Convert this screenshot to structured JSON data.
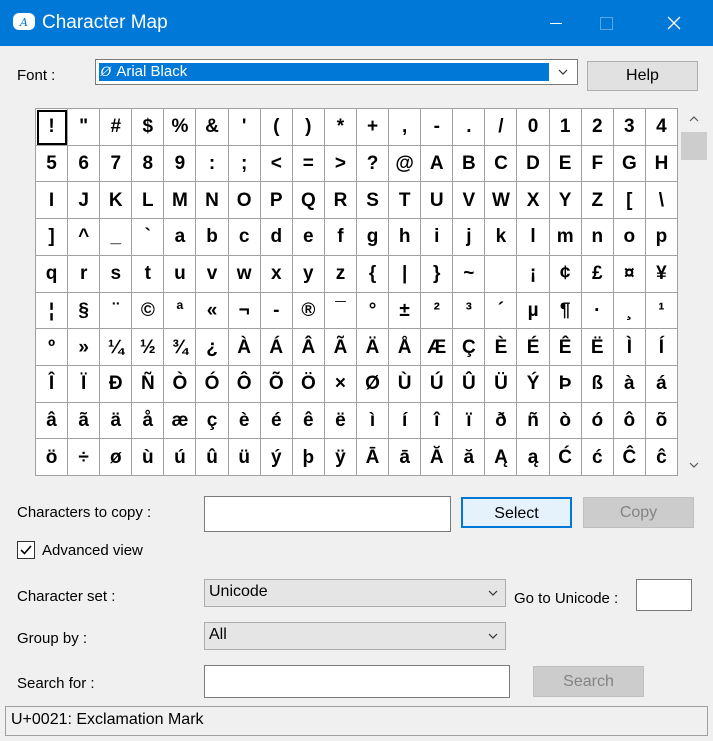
{
  "window": {
    "title": "Character Map",
    "icon": "character-map-app-icon"
  },
  "font_row": {
    "label": "Font :",
    "selected_font": "Arial Black",
    "font_icon": "opentype-font-icon",
    "help_label": "Help"
  },
  "grid": {
    "rows": [
      [
        "!",
        "\"",
        "#",
        "$",
        "%",
        "&",
        "'",
        "(",
        ")",
        "*",
        "+",
        ",",
        "-",
        ".",
        "/",
        "0",
        "1",
        "2",
        "3",
        "4"
      ],
      [
        "5",
        "6",
        "7",
        "8",
        "9",
        ":",
        ";",
        "<",
        "=",
        ">",
        "?",
        "@",
        "A",
        "B",
        "C",
        "D",
        "E",
        "F",
        "G",
        "H"
      ],
      [
        "I",
        "J",
        "K",
        "L",
        "M",
        "N",
        "O",
        "P",
        "Q",
        "R",
        "S",
        "T",
        "U",
        "V",
        "W",
        "X",
        "Y",
        "Z",
        "[",
        "\\"
      ],
      [
        "]",
        "^",
        "_",
        "`",
        "a",
        "b",
        "c",
        "d",
        "e",
        "f",
        "g",
        "h",
        "i",
        "j",
        "k",
        "l",
        "m",
        "n",
        "o",
        "p"
      ],
      [
        "q",
        "r",
        "s",
        "t",
        "u",
        "v",
        "w",
        "x",
        "y",
        "z",
        "{",
        "|",
        "}",
        "~",
        "",
        "¡",
        "¢",
        "£",
        "¤",
        "¥"
      ],
      [
        "¦",
        "§",
        "¨",
        "©",
        "ª",
        "«",
        "¬",
        "-",
        "®",
        "¯",
        "°",
        "±",
        "²",
        "³",
        "´",
        "µ",
        "¶",
        "·",
        "¸",
        "¹"
      ],
      [
        "º",
        "»",
        "¼",
        "½",
        "¾",
        "¿",
        "À",
        "Á",
        "Â",
        "Ã",
        "Ä",
        "Å",
        "Æ",
        "Ç",
        "È",
        "É",
        "Ê",
        "Ë",
        "Ì",
        "Í"
      ],
      [
        "Î",
        "Ï",
        "Ð",
        "Ñ",
        "Ò",
        "Ó",
        "Ô",
        "Õ",
        "Ö",
        "×",
        "Ø",
        "Ù",
        "Ú",
        "Û",
        "Ü",
        "Ý",
        "Þ",
        "ß",
        "à",
        "á"
      ],
      [
        "â",
        "ã",
        "ä",
        "å",
        "æ",
        "ç",
        "è",
        "é",
        "ê",
        "ë",
        "ì",
        "í",
        "î",
        "ï",
        "ð",
        "ñ",
        "ò",
        "ó",
        "ô",
        "õ"
      ],
      [
        "ö",
        "÷",
        "ø",
        "ù",
        "ú",
        "û",
        "ü",
        "ý",
        "þ",
        "ÿ",
        "Ā",
        "ā",
        "Ă",
        "ă",
        "Ą",
        "ą",
        "Ć",
        "ć",
        "Ĉ",
        "ĉ"
      ]
    ],
    "selected": "!"
  },
  "copy_row": {
    "label": "Characters to copy :",
    "value": "",
    "select_label": "Select",
    "copy_label": "Copy"
  },
  "advanced": {
    "label": "Advanced view",
    "checked": true
  },
  "charset": {
    "label": "Character set :",
    "value": "Unicode",
    "goto_label": "Go to Unicode :",
    "goto_value": ""
  },
  "groupby": {
    "label": "Group by :",
    "value": "All"
  },
  "search": {
    "label": "Search for :",
    "value": "",
    "button_label": "Search"
  },
  "status": {
    "text": "U+0021: Exclamation Mark"
  },
  "colors": {
    "titlebar": "#0078d7",
    "accent": "#0078d7",
    "window_bg": "#f0f0f0"
  }
}
